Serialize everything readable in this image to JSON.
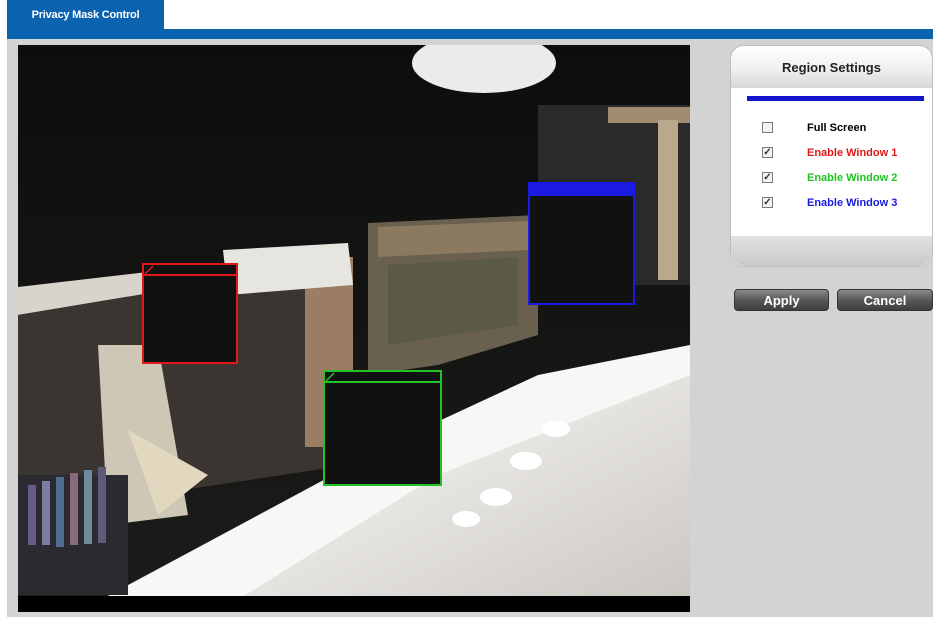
{
  "header": {
    "tab_label": "Privacy Mask Control"
  },
  "video": {
    "masks": [
      {
        "name": "Window 1",
        "color": "#e01818"
      },
      {
        "name": "Window 2",
        "color": "#22c322"
      },
      {
        "name": "Window 3",
        "color": "#1a1ae0"
      }
    ]
  },
  "region_settings": {
    "title": "Region Settings",
    "options": [
      {
        "label": "Full Screen",
        "checked": false,
        "color": "#000000"
      },
      {
        "label": "Enable Window 1",
        "checked": true,
        "color": "#e01818"
      },
      {
        "label": "Enable Window 2",
        "checked": true,
        "color": "#22c322"
      },
      {
        "label": "Enable Window 3",
        "checked": true,
        "color": "#1a1ae0"
      }
    ]
  },
  "buttons": {
    "apply": "Apply",
    "cancel": "Cancel"
  }
}
